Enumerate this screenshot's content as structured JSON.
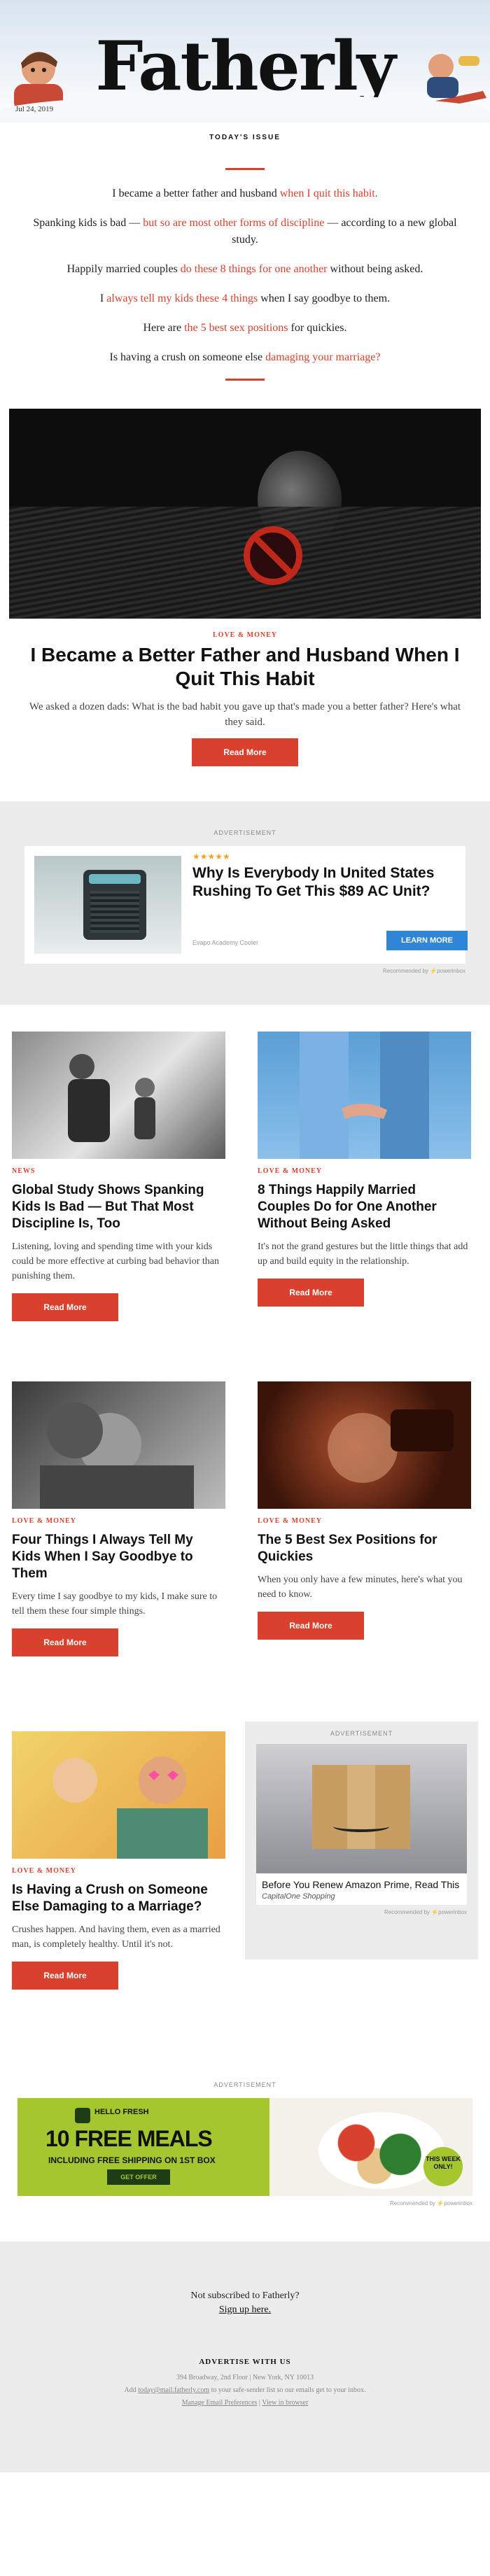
{
  "header": {
    "logo": "Fatherly",
    "date": "Jul 24, 2019",
    "issue_label": "TODAY'S ISSUE"
  },
  "teasers": [
    {
      "before": "I became a better father and husband ",
      "link": "when I quit this habit.",
      "after": ""
    },
    {
      "before": "Spanking kids is bad — ",
      "link": "but so are most other forms of discipline",
      "after": " — according to a new global study."
    },
    {
      "before": "Happily married couples ",
      "link": "do these 8 things for one another",
      "after": " without being asked."
    },
    {
      "before": "I ",
      "link": "always tell my kids these 4 things",
      "after": " when I say goodbye to them."
    },
    {
      "before": "Here are ",
      "link": "the 5 best sex positions",
      "after": " for quickies."
    },
    {
      "before": "Is having a crush on someone else ",
      "link": "damaging your marriage?",
      "after": ""
    }
  ],
  "hero": {
    "kicker": "LOVE & MONEY",
    "title": "I Became a Better Father and Husband When I Quit This Habit",
    "dek": "We asked a dozen dads: What is the bad habit you gave up that's made you a better father? Here's what they said.",
    "button": "Read More"
  },
  "ad1": {
    "label": "ADVERTISEMENT",
    "stars": "★★★★★",
    "title": "Why Is Everybody In United States Rushing To Get This $89 AC Unit?",
    "source": "Evapo Academy Cooler",
    "button": "LEARN MORE",
    "recommended": "Recommended by ⚡powerinbox"
  },
  "articles": [
    {
      "kicker": "NEWS",
      "title": "Global Study Shows Spanking Kids Is Bad — But That Most Discipline Is, Too",
      "dek": "Listening, loving and spending time with your kids could be more effective at curbing bad behavior than punishing them.",
      "button": "Read More"
    },
    {
      "kicker": "LOVE & MONEY",
      "title": "8 Things Happily Married Couples Do for One Another Without Being Asked",
      "dek": "It's not the grand gestures but the little things that add up and build equity in the relationship.",
      "button": "Read More"
    },
    {
      "kicker": "LOVE & MONEY",
      "title": "Four Things I Always Tell My Kids When I Say Goodbye to Them",
      "dek": "Every time I say goodbye to my kids, I make sure to tell them these four simple things.",
      "button": "Read More"
    },
    {
      "kicker": "LOVE & MONEY",
      "title": "The 5 Best Sex Positions for Quickies",
      "dek": "When you only have a few minutes, here's what you need to know.",
      "button": "Read More"
    },
    {
      "kicker": "LOVE & MONEY",
      "title": "Is Having a Crush on Someone Else Damaging to a Marriage?",
      "dek": "Crushes happen. And having them, even as a married man, is completely healthy. Until it's not.",
      "button": "Read More"
    }
  ],
  "side_ad": {
    "label": "ADVERTISEMENT",
    "title": "Before You Renew Amazon Prime, Read This",
    "source": "CapitalOne Shopping",
    "recommended": "Recommended by ⚡powerinbox"
  },
  "ad3": {
    "label": "ADVERTISEMENT",
    "logo": "HELLO FRESH",
    "headline": "10 FREE MEALS",
    "sub": "INCLUDING FREE SHIPPING ON 1ST BOX",
    "button": "GET OFFER",
    "badge": "THIS WEEK ONLY!",
    "recommended": "Recommended by ⚡powerinbox"
  },
  "footer": {
    "question": "Not subscribed to Fatherly?",
    "signup": "Sign up here.",
    "advertise": "ADVERTISE WITH US",
    "address": "394 Broadway, 2nd Floor | New York, NY 10013",
    "add_before": "Add ",
    "add_email": "today@mail.fatherly.com",
    "add_after": " to your safe-sender list so our emails get to your inbox.",
    "manage": "Manage Email Preferences",
    "sep": " | ",
    "browser": "View in browser"
  },
  "colors": {
    "accent": "#d9412e",
    "ad_button": "#2f86d6",
    "hellofresh": "#a4c72f"
  }
}
